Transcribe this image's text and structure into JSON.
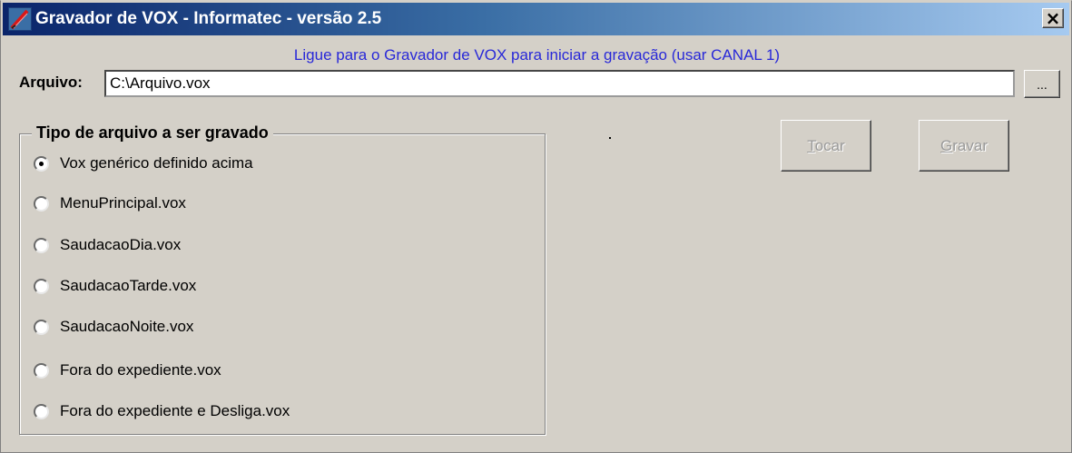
{
  "window": {
    "title": "Gravador de VOX - Informatec - versão 2.5",
    "close_label": "×"
  },
  "info_text": "Ligue para o Gravador de VOX para iniciar a gravação (usar CANAL 1)",
  "file": {
    "label": "Arquivo:",
    "value": "C:\\Arquivo.vox",
    "browse_label": "..."
  },
  "group": {
    "title": "Tipo de arquivo a ser gravado",
    "options": [
      {
        "label": "Vox genérico definido acima",
        "checked": true
      },
      {
        "label": "MenuPrincipal.vox",
        "checked": false
      },
      {
        "label": "SaudacaoDia.vox",
        "checked": false
      },
      {
        "label": "SaudacaoTarde.vox",
        "checked": false
      },
      {
        "label": "SaudacaoNoite.vox",
        "checked": false
      },
      {
        "label": "Fora do expediente.vox",
        "checked": false
      },
      {
        "label": "Fora do expediente e Desliga.vox",
        "checked": false
      }
    ]
  },
  "buttons": {
    "play": {
      "first": "T",
      "rest": "ocar",
      "enabled": false
    },
    "record": {
      "first": "G",
      "rest": "ravar",
      "enabled": false
    }
  },
  "colors": {
    "titlebar_start": "#0a246a",
    "titlebar_end": "#a6caf0",
    "info_text": "#2828d8",
    "disabled_text": "#9a9a9a"
  }
}
